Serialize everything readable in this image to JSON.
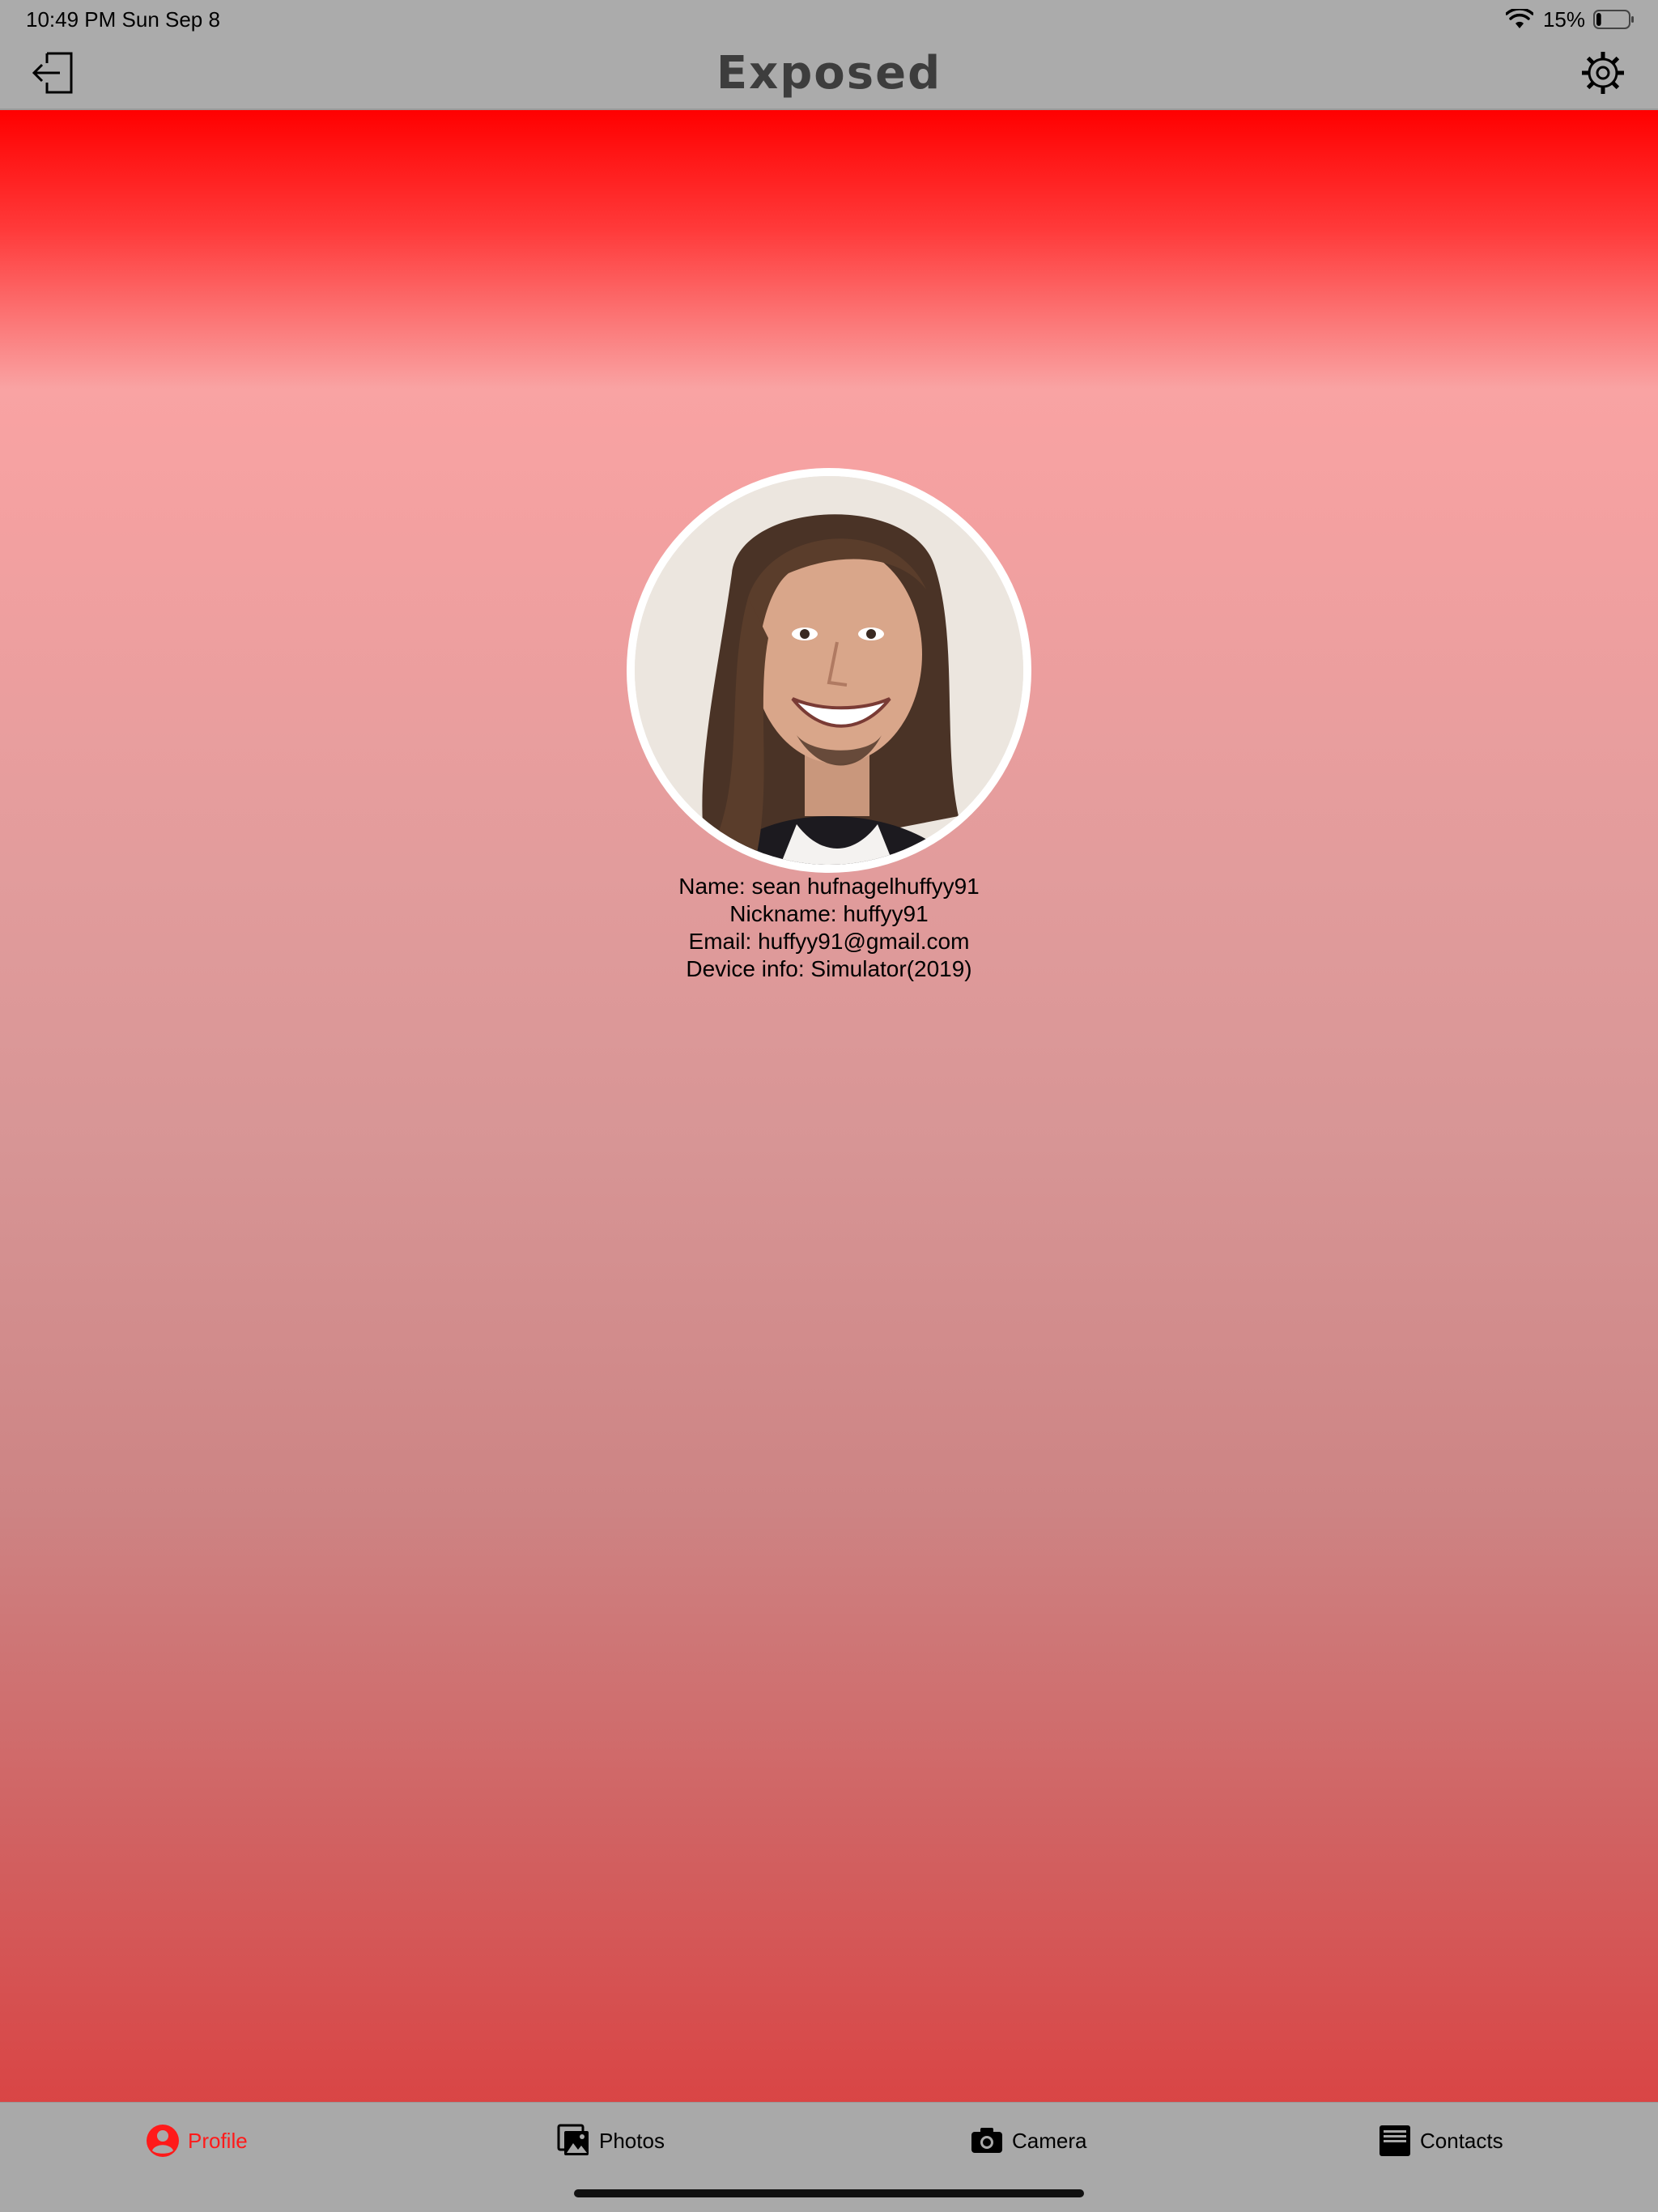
{
  "status_bar": {
    "time": "10:49 PM   Sun Sep 8",
    "battery_percent": "15%",
    "battery_level": 0.15,
    "wifi_icon": "wifi-icon",
    "battery_icon": "battery-icon"
  },
  "nav": {
    "title": "Exposed",
    "left_icon": "logout-icon",
    "right_icon": "gear-icon"
  },
  "profile": {
    "photo_icon": "profile-photo",
    "name_line": "Name: sean hufnagelhuffyy91",
    "nickname_line": "Nickname: huffyy91",
    "email_line": "Email: huffyy91@gmail.com",
    "device_line": "Device info: Simulator(2019)"
  },
  "tabs": [
    {
      "label": "Profile",
      "icon": "person-circle-icon",
      "active": true
    },
    {
      "label": "Photos",
      "icon": "photos-icon",
      "active": false
    },
    {
      "label": "Camera",
      "icon": "camera-icon",
      "active": false
    },
    {
      "label": "Contacts",
      "icon": "contacts-icon",
      "active": false
    }
  ],
  "colors": {
    "accent": "#ff0000",
    "bar_background": "#ababab",
    "active_tab": "#ff1a1a"
  }
}
